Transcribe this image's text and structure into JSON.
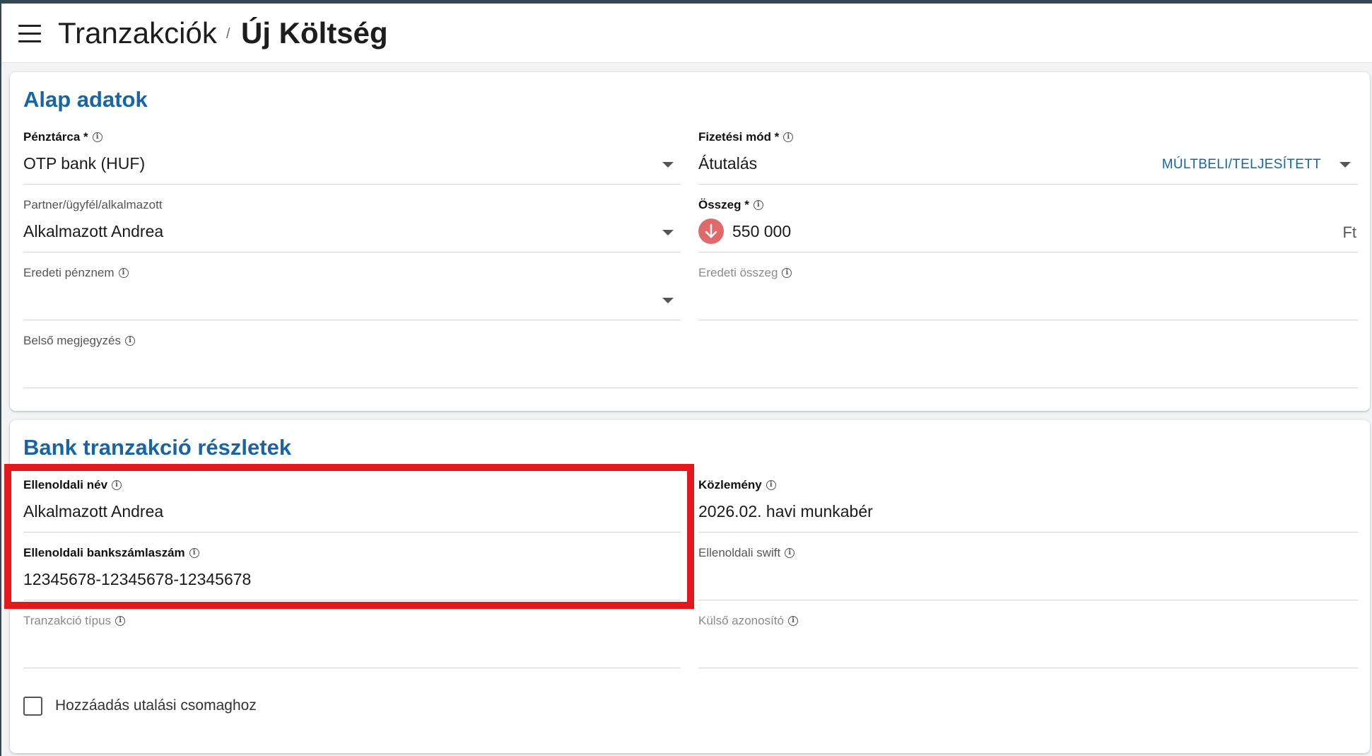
{
  "header": {
    "menu_icon": "hamburger-menu-icon",
    "breadcrumb_root": "Tranzakciók",
    "breadcrumb_separator": "/",
    "page_title": "Új Költség"
  },
  "sections": {
    "basic": {
      "title": "Alap adatok",
      "wallet": {
        "label": "Pénztárca *",
        "value": "OTP bank (HUF)"
      },
      "payment_method": {
        "label": "Fizetési mód *",
        "value": "Átutalás",
        "status_link": "MÚLTBELI/TELJESÍTETT"
      },
      "partner": {
        "label": "Partner/ügyfél/alkalmazott",
        "value": "Alkalmazott Andrea"
      },
      "amount": {
        "label": "Összeg *",
        "value": "550 000",
        "currency": "Ft",
        "direction_icon": "arrow-down-icon",
        "direction_color": "#e06a6a"
      },
      "original_currency": {
        "label": "Eredeti pénznem",
        "value": ""
      },
      "original_amount": {
        "label": "Eredeti összeg",
        "value": ""
      },
      "internal_note": {
        "label": "Belső megjegyzés",
        "value": ""
      }
    },
    "bank": {
      "title": "Bank tranzakció részletek",
      "counterparty_name": {
        "label": "Ellenoldali név",
        "value": "Alkalmazott Andrea"
      },
      "remittance": {
        "label": "Közlemény",
        "value": "2026.02. havi munkabér"
      },
      "counterparty_account": {
        "label": "Ellenoldali bankszámlaszám",
        "value": "12345678-12345678-12345678"
      },
      "counterparty_swift": {
        "label": "Ellenoldali swift",
        "value": ""
      },
      "transaction_type": {
        "label": "Tranzakció típus",
        "value": ""
      },
      "external_id": {
        "label": "Külső azonosító",
        "value": ""
      },
      "add_to_batch": {
        "label": "Hozzáadás utalási csomaghoz",
        "checked": false
      }
    }
  },
  "colors": {
    "accent": "#1565a8",
    "highlight": "#e3181b"
  }
}
